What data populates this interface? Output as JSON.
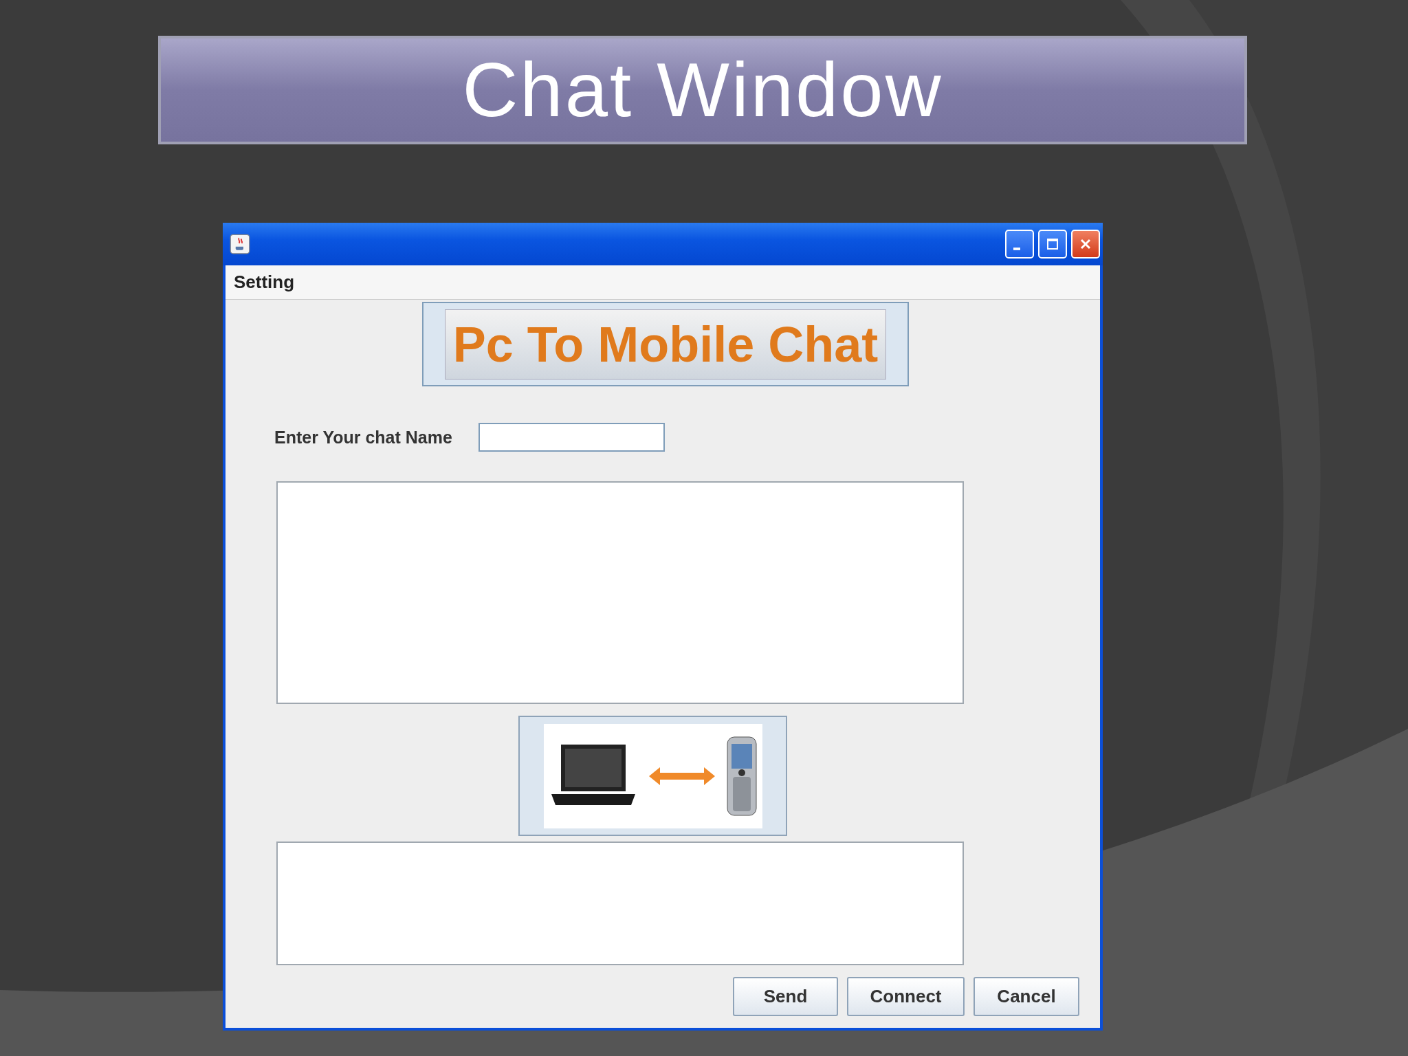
{
  "slide_title": "Chat Window",
  "window": {
    "menu": [
      "Setting"
    ],
    "banner": "Pc To Mobile Chat",
    "name_label": "Enter Your chat Name",
    "buttons": [
      "Send",
      "Connect",
      "Cancel"
    ]
  }
}
